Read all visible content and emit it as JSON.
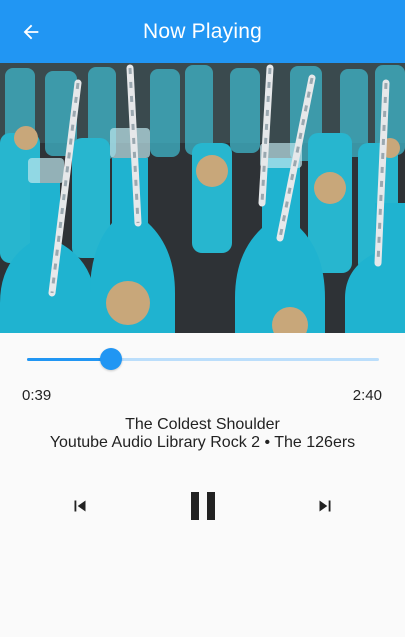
{
  "appbar": {
    "title": "Now Playing",
    "back_icon": "arrow-back-icon",
    "background_color": "#2196f3"
  },
  "album_art": {
    "description_icon": "album-art-image"
  },
  "player": {
    "elapsed": "0:39",
    "total": "2:40",
    "progress_fraction": 0.24,
    "accent_color": "#2196f3",
    "track_inactive_color": "#bbdefb"
  },
  "track": {
    "title": "The Coldest Shoulder",
    "subtitle": "Youtube Audio Library Rock 2 • The 126ers"
  },
  "controls": {
    "previous_icon": "skip-previous-icon",
    "pause_icon": "pause-icon",
    "next_icon": "skip-next-icon"
  }
}
